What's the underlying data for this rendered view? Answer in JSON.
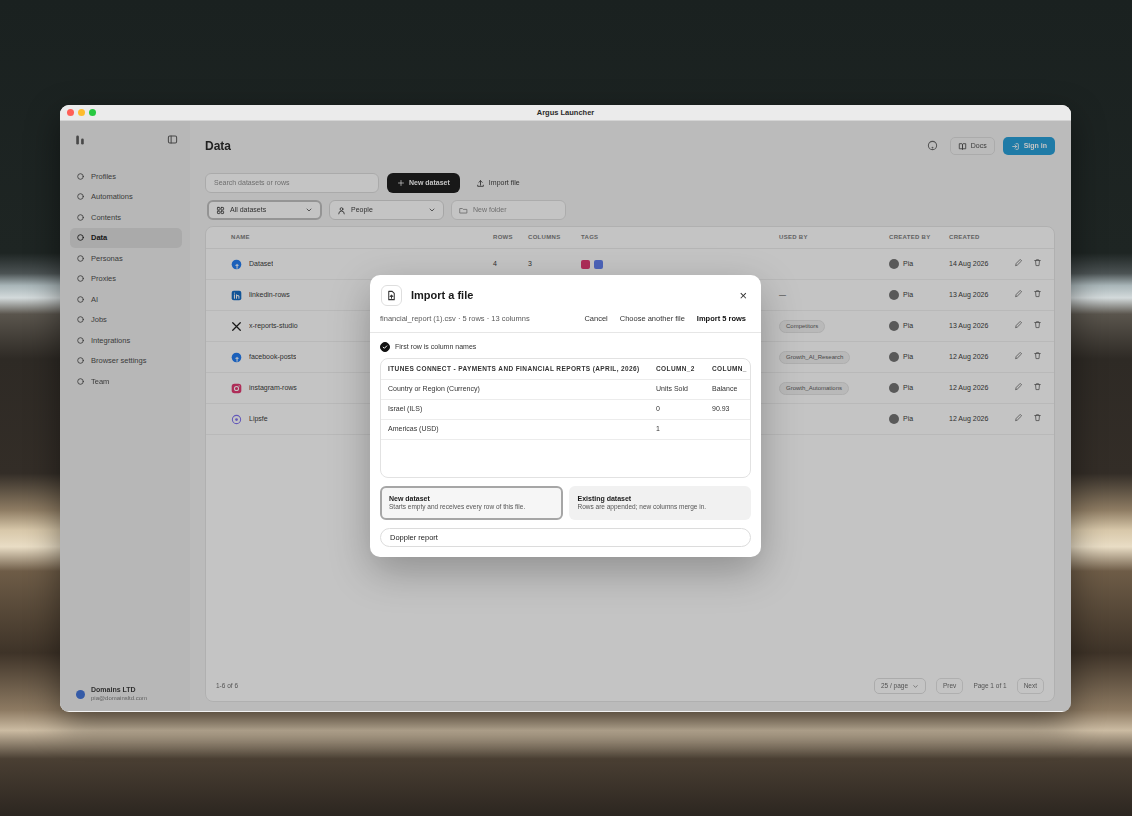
{
  "window": {
    "title": "Argus Launcher"
  },
  "sidebar": {
    "items": [
      {
        "label": "Profiles",
        "selected": false
      },
      {
        "label": "Automations",
        "selected": false
      },
      {
        "label": "Contents",
        "selected": false
      },
      {
        "label": "Data",
        "selected": true
      },
      {
        "label": "Personas",
        "selected": false
      },
      {
        "label": "Proxies",
        "selected": false
      },
      {
        "label": "AI",
        "selected": false
      },
      {
        "label": "Jobs",
        "selected": false
      },
      {
        "label": "Integrations",
        "selected": false
      },
      {
        "label": "Browser settings",
        "selected": false
      },
      {
        "label": "Team",
        "selected": false
      }
    ],
    "account": {
      "name": "Domains LTD",
      "detail": "pia@domainsltd.com"
    }
  },
  "page": {
    "title": "Data",
    "docs": "Docs",
    "sign_in": "Sign in"
  },
  "toolbar": {
    "search": {
      "placeholder": "Search datasets or rows"
    },
    "new_button": "New dataset",
    "import_button": "Import file"
  },
  "filters": [
    {
      "label": "All datasets",
      "kind": "grid"
    },
    {
      "label": "People",
      "kind": "people"
    }
  ],
  "folder_field": {
    "placeholder": "New folder"
  },
  "table": {
    "columns": [
      "NAME",
      "ROWS",
      "COLUMNS",
      "TAGS",
      "USED BY",
      "CREATED BY",
      "CREATED"
    ],
    "rows": [
      {
        "kind": "facebook",
        "color": "#1877f2",
        "name": "Dataset",
        "rows": "4",
        "columns": "3",
        "tags": [
          {
            "color": "#e1306c"
          },
          {
            "color": "#5b7bf0"
          }
        ],
        "used_by": {
          "label": "",
          "kind": "none"
        },
        "created_by": "Pia",
        "created": "14 Aug 2026"
      },
      {
        "kind": "linkedin",
        "color": "#0a66c2",
        "name": "linkedin-rows",
        "rows": "",
        "columns": "",
        "tags": [],
        "used_by": {
          "label": "—",
          "kind": "plain"
        },
        "created_by": "Pia",
        "created": "13 Aug 2026"
      },
      {
        "kind": "x",
        "color": "#111111",
        "name": "x-reports-studio",
        "rows": "",
        "columns": "",
        "tags": [],
        "used_by": {
          "label": "Competitors",
          "kind": "chip"
        },
        "created_by": "Pia",
        "created": "13 Aug 2026"
      },
      {
        "kind": "facebook",
        "color": "#1877f2",
        "name": "facebook-posts",
        "rows": "",
        "columns": "",
        "tags": [],
        "used_by": {
          "label": "Growth_AI_Research",
          "kind": "chip"
        },
        "created_by": "Pia",
        "created": "12 Aug 2026"
      },
      {
        "kind": "instagram",
        "color": "#e1306c",
        "name": "instagram-rows",
        "rows": "",
        "columns": "",
        "tags": [],
        "used_by": {
          "label": "Growth_Automations",
          "kind": "chip"
        },
        "created_by": "Pia",
        "created": "12 Aug 2026"
      },
      {
        "kind": "ring",
        "color": "#7b6cf0",
        "name": "Lipsfe",
        "rows": "",
        "columns": "",
        "tags": [],
        "used_by": {
          "label": "",
          "kind": "none"
        },
        "created_by": "Pia",
        "created": "12 Aug 2026"
      }
    ]
  },
  "pagination": {
    "summary": "1-6 of 6",
    "page_size": "25 / page",
    "prev": "Prev",
    "page": "Page 1 of 1",
    "next": "Next"
  },
  "modal": {
    "title": "Import a file",
    "close": "×",
    "file_info": "financial_report (1).csv · 5 rows · 13 columns",
    "actions": [
      "Cancel",
      "Choose another file",
      "Import 5 rows"
    ],
    "header_option": {
      "label": "First row is column names",
      "checked": true
    },
    "preview": {
      "columns": [
        "ITUNES CONNECT - PAYMENTS AND FINANCIAL REPORTS (APRIL, 2026)",
        "COLUMN_2",
        "COLUMN_"
      ],
      "rows": [
        [
          "Country or Region (Currency)",
          "Units Sold",
          "Balance"
        ],
        [
          "Israel (ILS)",
          "0",
          "90.93"
        ],
        [
          "Americas (USD)",
          "1",
          ""
        ],
        [
          "",
          "",
          ""
        ]
      ]
    },
    "targets": [
      {
        "title": "New dataset",
        "description": "Starts empty and receives every row of this file.",
        "selected": true
      },
      {
        "title": "Existing dataset",
        "description": "Rows are appended; new columns merge in.",
        "selected": false
      }
    ],
    "name_input": {
      "value": "Doppler report"
    }
  }
}
